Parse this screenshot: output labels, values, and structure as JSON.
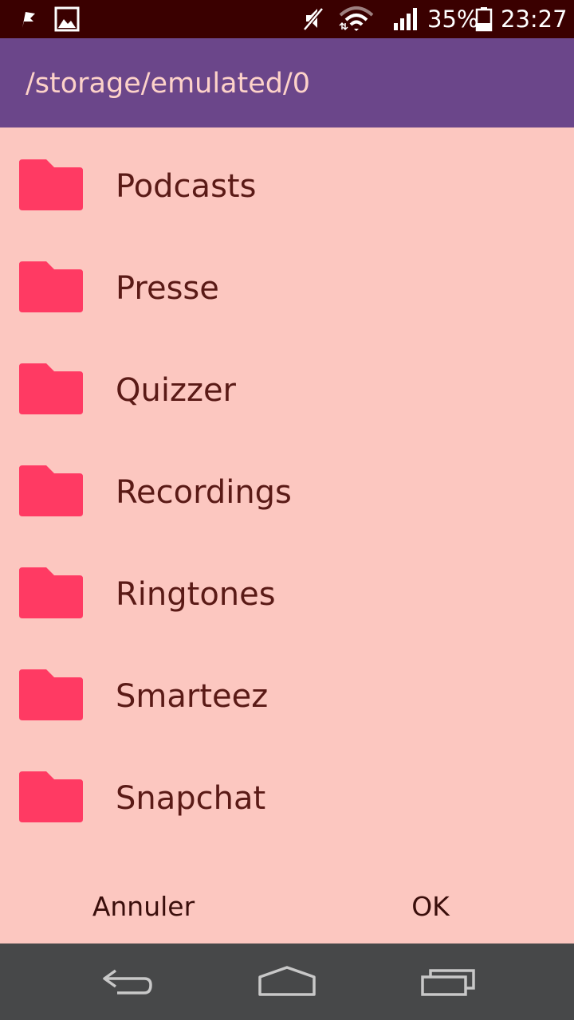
{
  "status_bar": {
    "battery_percent": "35%",
    "time": "23:27",
    "icons": [
      "flag-icon",
      "image-icon",
      "mute-icon",
      "wifi-icon",
      "signal-icon",
      "battery-icon"
    ]
  },
  "title": "/storage/emulated/0",
  "folders": [
    {
      "label": "Podcasts",
      "icon": "folder-icon"
    },
    {
      "label": "Presse",
      "icon": "folder-icon"
    },
    {
      "label": "Quizzer",
      "icon": "folder-icon"
    },
    {
      "label": "Recordings",
      "icon": "folder-icon"
    },
    {
      "label": "Ringtones",
      "icon": "folder-icon"
    },
    {
      "label": "Smarteez",
      "icon": "folder-icon"
    },
    {
      "label": "Snapchat",
      "icon": "folder-icon"
    }
  ],
  "buttons": {
    "cancel_label": "Annuler",
    "ok_label": "OK"
  },
  "nav_bar": {
    "icons": [
      "back-icon",
      "home-icon",
      "recents-icon"
    ]
  },
  "colors": {
    "status_bar": "#3a0000",
    "title_bar": "#6b468a",
    "title_text": "#fdd2c9",
    "background": "#fcc7c0",
    "folder_icon": "#ff3a63",
    "folder_text": "#5a1a16",
    "nav_bar": "#474849"
  }
}
